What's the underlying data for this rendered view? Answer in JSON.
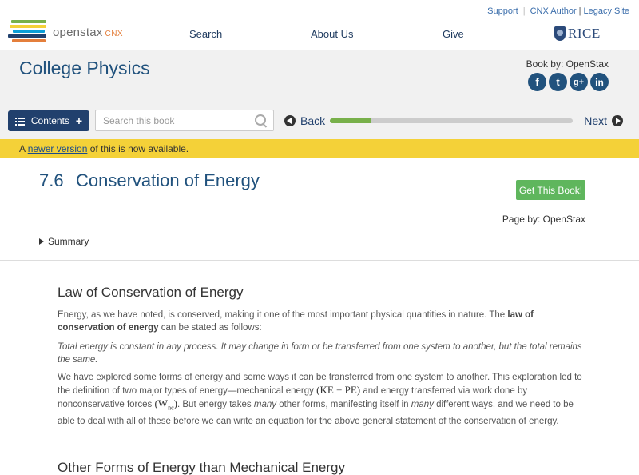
{
  "header": {
    "logo_text": "openstax",
    "logo_sub": "CNX",
    "util_links": {
      "support": "Support",
      "cnx_author": "CNX Author",
      "legacy": "Legacy Site"
    },
    "nav": {
      "search": "Search",
      "about": "About Us",
      "give": "Give"
    },
    "partner": "RICE"
  },
  "book": {
    "title": "College Physics",
    "book_by": "Book by: OpenStax",
    "social": [
      "f",
      "t",
      "g+",
      "in"
    ]
  },
  "toolbar": {
    "contents_label": "Contents",
    "search_placeholder": "Search this book",
    "back_label": "Back",
    "next_label": "Next",
    "progress_fraction": 0.17
  },
  "banner": {
    "prefix": "A",
    "link": "newer version",
    "suffix": "of this is now available."
  },
  "page": {
    "section_number": "7.6",
    "section_title": "Conservation of Energy",
    "get_book_label": "Get This Book!",
    "page_by": "Page by: OpenStax",
    "summary_label": "Summary"
  },
  "content": {
    "heading1": "Law of Conservation of Energy",
    "p1_a": "Energy, as we have noted, is conserved, making it one of the most important physical quantities in nature. The",
    "p1_bold": "law of conservation of energy",
    "p1_b": "can be stated as follows:",
    "p2_italic": "Total energy is constant in any process. It may change in form or be transferred from one system to another, but the total remains the same.",
    "p3_a": "We have explored some forms of energy and some ways it can be transferred from one system to another. This exploration led to the definition of two major types of energy—mechanical energy",
    "p3_math1": "(KE + PE)",
    "p3_b": "and energy transferred via work done by nonconservative forces",
    "p3_math2_base": "(W",
    "p3_math2_sub": "nc",
    "p3_math2_close": ")",
    "p3_c": ". But energy takes",
    "p3_many1": "many",
    "p3_d": "other forms, manifesting itself in",
    "p3_many2": "many",
    "p3_e": "different ways, and we need to be able to deal with all of these before we can write an equation for the above general statement of the conservation of energy.",
    "heading2": "Other Forms of Energy than Mechanical Energy"
  },
  "colors": {
    "brand_blue": "#21527d",
    "contents_button": "#21406d",
    "banner_yellow": "#f4d138",
    "get_book_green": "#5fb65d",
    "progress_green": "#78b04a"
  }
}
